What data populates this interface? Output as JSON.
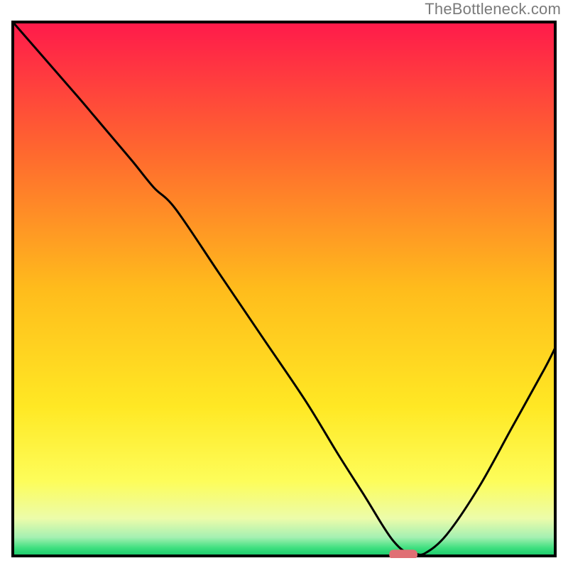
{
  "watermark": "TheBottleneck.com",
  "chart_data": {
    "type": "line",
    "title": "",
    "xlabel": "",
    "ylabel": "",
    "xlim": [
      0,
      100
    ],
    "ylim": [
      0,
      100
    ],
    "grid": false,
    "legend": false,
    "background": {
      "type": "vertical-gradient",
      "stops": [
        {
          "pos": 0.0,
          "color": "#ff1a4b"
        },
        {
          "pos": 0.25,
          "color": "#ff6a2e"
        },
        {
          "pos": 0.5,
          "color": "#ffbc1c"
        },
        {
          "pos": 0.72,
          "color": "#ffe824"
        },
        {
          "pos": 0.86,
          "color": "#fdfd5a"
        },
        {
          "pos": 0.93,
          "color": "#ecfcaa"
        },
        {
          "pos": 0.965,
          "color": "#a5f0b2"
        },
        {
          "pos": 0.985,
          "color": "#3fe07f"
        },
        {
          "pos": 1.0,
          "color": "#17c96a"
        }
      ]
    },
    "series": [
      {
        "name": "bottleneck-curve",
        "color": "#000000",
        "x": [
          0,
          6,
          12,
          17,
          22,
          26,
          30,
          38,
          46,
          54,
          60,
          65,
          68,
          70,
          72,
          74,
          76,
          80,
          86,
          92,
          98,
          100
        ],
        "y": [
          100,
          93,
          86,
          80,
          74,
          69,
          65,
          53,
          41,
          29,
          19,
          11,
          6,
          3,
          1,
          0.5,
          0.5,
          4,
          13,
          24,
          35,
          39
        ]
      }
    ],
    "markers": [
      {
        "name": "optimal-point",
        "shape": "rounded-rect",
        "x": 72,
        "y": 0,
        "width_pct": 5.2,
        "height_pct": 1.8,
        "fill": "#e06f74"
      }
    ]
  }
}
